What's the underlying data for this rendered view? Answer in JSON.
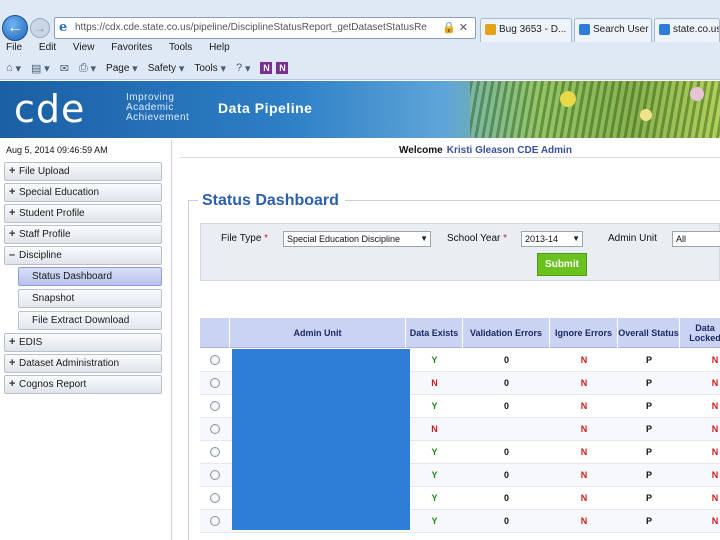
{
  "browser": {
    "url": "https://cdx.cde.state.co.us/pipeline/DisciplineStatusReport_getDatasetStatusReport",
    "tabs": [
      {
        "label": "Bug 3653 - D..."
      },
      {
        "label": "Search User"
      },
      {
        "label": "state.co.us"
      }
    ],
    "menu": [
      "File",
      "Edit",
      "View",
      "Favorites",
      "Tools",
      "Help"
    ],
    "commands": [
      "Page",
      "Safety",
      "Tools"
    ]
  },
  "banner": {
    "logo": "cde",
    "tagline": [
      "Improving",
      "Academic",
      "Achievement"
    ],
    "title": "Data Pipeline"
  },
  "datestamp": "Aug 5, 2014 09:46:59 AM",
  "welcome": {
    "label": "Welcome",
    "user": "Kristi Gleason CDE Admin"
  },
  "sidebar": {
    "items": [
      {
        "sign": "+",
        "label": "File Upload"
      },
      {
        "sign": "+",
        "label": "Special Education"
      },
      {
        "sign": "+",
        "label": "Student Profile"
      },
      {
        "sign": "+",
        "label": "Staff Profile"
      },
      {
        "sign": "–",
        "label": "Discipline"
      }
    ],
    "subitems": [
      {
        "label": "Status Dashboard",
        "active": true
      },
      {
        "label": "Snapshot"
      },
      {
        "label": "File Extract Download"
      }
    ],
    "items_after": [
      {
        "sign": "+",
        "label": "EDIS"
      },
      {
        "sign": "+",
        "label": "Dataset Administration"
      },
      {
        "sign": "+",
        "label": "Cognos Report"
      }
    ]
  },
  "dashboard": {
    "title": "Status Dashboard",
    "filters": {
      "file_type_label": "File Type",
      "file_type_value": "Special Education Discipline",
      "school_year_label": "School Year",
      "school_year_value": "2013-14",
      "admin_unit_label": "Admin Unit",
      "admin_unit_value": "All",
      "required_mark": "*"
    },
    "submit_label": "Submit"
  },
  "table": {
    "headers": [
      "Admin Unit",
      "Data Exists",
      "Validation Errors",
      "Ignore Errors",
      "Overall Status",
      "Data Locked"
    ],
    "rows": [
      {
        "exists": "Y",
        "validation": "0",
        "ignore": "N",
        "status": "P",
        "locked": "N"
      },
      {
        "exists": "N",
        "validation": "0",
        "ignore": "N",
        "status": "P",
        "locked": "N"
      },
      {
        "exists": "Y",
        "validation": "0",
        "ignore": "N",
        "status": "P",
        "locked": "N"
      },
      {
        "exists": "N",
        "validation": "",
        "ignore": "N",
        "status": "P",
        "locked": "N"
      },
      {
        "exists": "Y",
        "validation": "0",
        "ignore": "N",
        "status": "P",
        "locked": "N"
      },
      {
        "exists": "Y",
        "validation": "0",
        "ignore": "N",
        "status": "P",
        "locked": "N"
      },
      {
        "exists": "Y",
        "validation": "0",
        "ignore": "N",
        "status": "P",
        "locked": "N"
      },
      {
        "exists": "Y",
        "validation": "0",
        "ignore": "N",
        "status": "P",
        "locked": "N"
      }
    ]
  },
  "colors": {
    "accent_blue": "#2b5fb0",
    "submit_green": "#6ac21e",
    "yes_green": "#1e8a1e",
    "no_red": "#d01a1a",
    "header_lavender": "#cbd3f2",
    "redaction_blue": "#2e7ed8"
  }
}
